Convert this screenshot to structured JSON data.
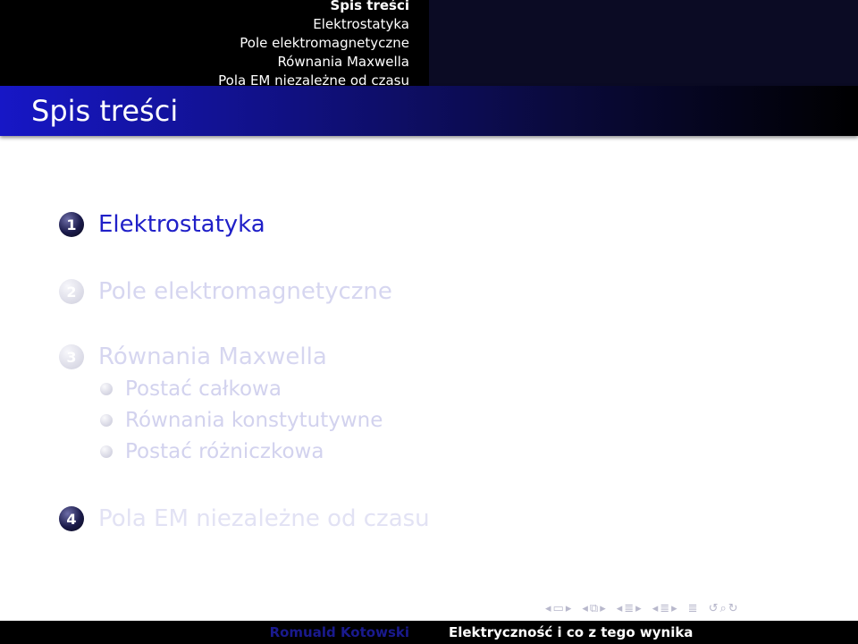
{
  "headline": {
    "sections": [
      "Spis treści",
      "Elektrostatyka",
      "Pole elektromagnetyczne",
      "Równania Maxwella",
      "Pola EM niezależne od czasu"
    ]
  },
  "frame_title": "Spis treści",
  "toc": {
    "sections": [
      {
        "number": "1",
        "label": "Elektrostatyka"
      },
      {
        "number": "2",
        "label": "Pole elektromagnetyczne"
      },
      {
        "number": "3",
        "label": "Równania Maxwella",
        "subsections": [
          "Postać całkowa",
          "Równania konstytutywne",
          "Postać różniczkowa"
        ]
      },
      {
        "number": "4",
        "label": "Pola EM niezależne od czasu"
      }
    ]
  },
  "footer": {
    "author": "Romuald Kotowski",
    "title": "Elektryczność i co z tego wynika"
  },
  "colors": {
    "accent": "#2020c8",
    "headline_bg": "#000000",
    "frametitle_start": "#1717c6"
  },
  "icons": {
    "nav": [
      "nav-frame-icon",
      "nav-subsection-icon",
      "nav-section-icon",
      "nav-document-icon",
      "nav-search-icon"
    ]
  }
}
